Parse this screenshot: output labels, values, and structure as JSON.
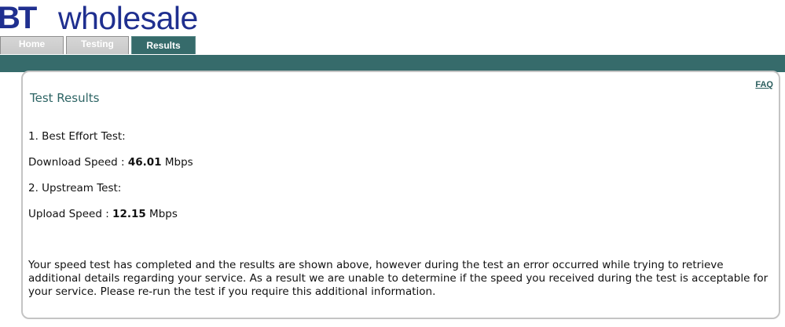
{
  "brand": {
    "logo_bt": "BT",
    "logo_word": "wholesale",
    "color": "#1f2f8f"
  },
  "tabs": [
    {
      "label": "Home",
      "active": false
    },
    {
      "label": "Testing",
      "active": false
    },
    {
      "label": "Results",
      "active": true
    }
  ],
  "accent_color": "#366b6b",
  "panel": {
    "faq_link": "FAQ",
    "title": "Test Results",
    "best_effort_heading": "1. Best Effort Test:",
    "download": {
      "label": "Download Speed : ",
      "value": "46.01",
      "unit": " Mbps"
    },
    "upstream_heading": "2. Upstream Test:",
    "upload": {
      "label": "Upload Speed : ",
      "value": "12.15",
      "unit": " Mbps"
    },
    "message": "Your speed test has completed and the results are shown above, however during the test an error occurred while trying to retrieve additional details regarding your service. As a result we are unable to determine if the speed you received during the test is acceptable for your service. Please re-run the test if you require this additional information."
  }
}
